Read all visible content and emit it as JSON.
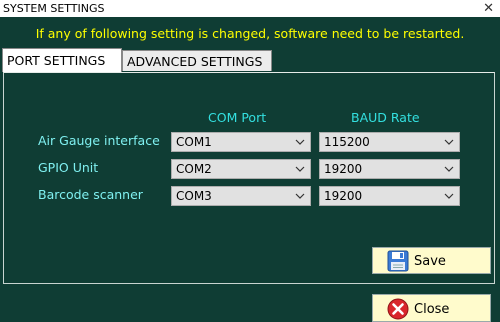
{
  "window": {
    "title": "SYSTEM SETTINGS",
    "close_glyph": "✕"
  },
  "warning": "If any of following setting is changed, software need to be restarted.",
  "tabs": [
    {
      "label": "PORT SETTINGS",
      "active": true
    },
    {
      "label": "ADVANCED SETTINGS",
      "active": false
    }
  ],
  "columns": {
    "com_port": "COM Port",
    "baud_rate": "BAUD Rate"
  },
  "rows": [
    {
      "label": "Air Gauge interface",
      "com": "COM1",
      "baud": "115200"
    },
    {
      "label": "GPIO Unit",
      "com": "COM2",
      "baud": "19200"
    },
    {
      "label": "Barcode scanner",
      "com": "COM3",
      "baud": "19200"
    }
  ],
  "buttons": {
    "save": "Save",
    "close": "Close"
  },
  "colors": {
    "background": "#0f3d34",
    "warning": "#ffff00",
    "header": "#33e0e0",
    "button": "#fffbcc"
  },
  "icons": {
    "save": "floppy-disk-icon",
    "close": "red-x-circle-icon",
    "dropdown": "chevron-down-icon"
  }
}
